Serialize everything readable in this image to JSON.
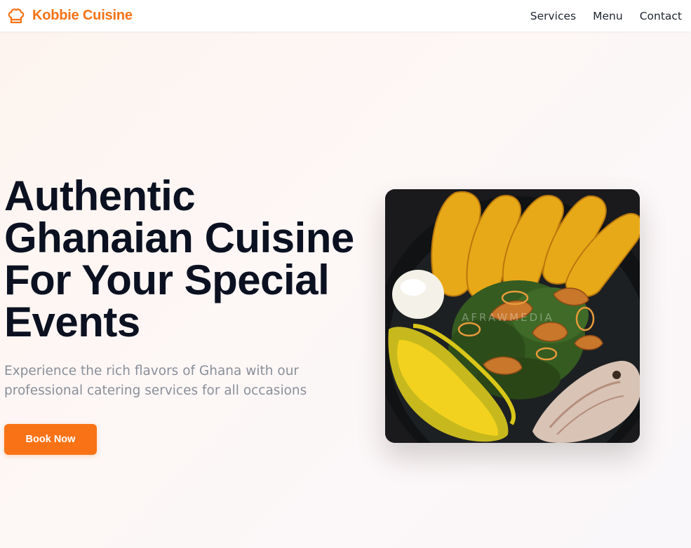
{
  "brand": {
    "name": "Kobbie Cuisine",
    "icon": "chef-hat-icon",
    "color": "#f47216"
  },
  "nav": {
    "items": [
      {
        "label": "Services"
      },
      {
        "label": "Menu"
      },
      {
        "label": "Contact"
      }
    ]
  },
  "hero": {
    "title": "Authentic Ghanaian Cuisine For Your Special Events",
    "subtitle": "Experience the rich flavors of Ghana with our professional catering services for all occasions",
    "cta_label": "Book Now",
    "cta_color": "#f97316",
    "image_watermark": "AFRAWMEDIA"
  }
}
